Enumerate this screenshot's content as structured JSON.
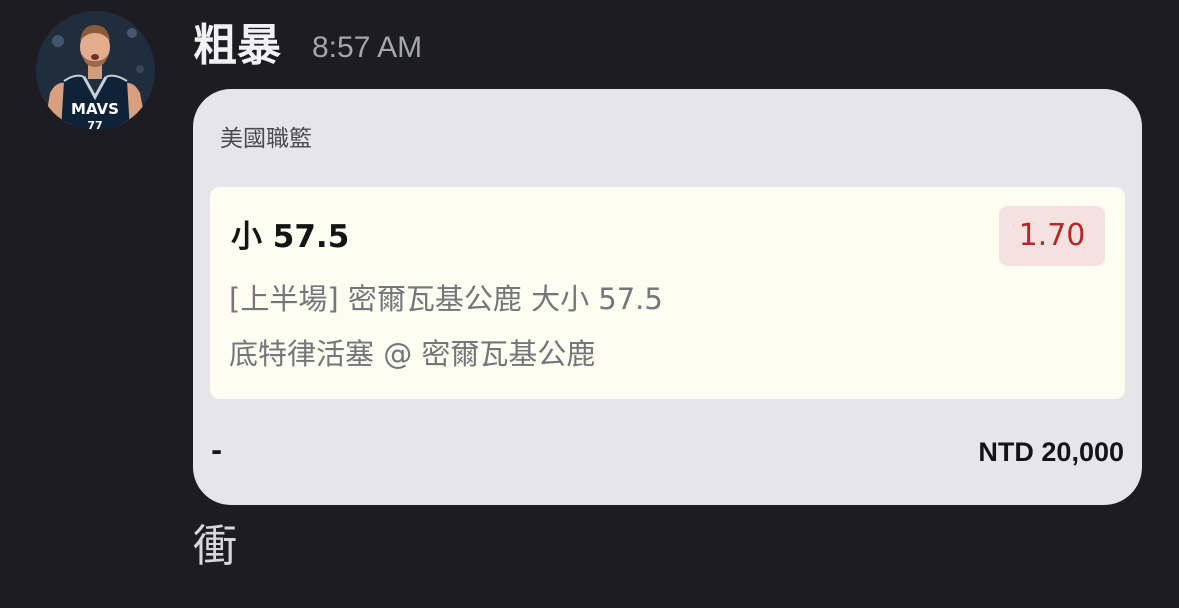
{
  "message": {
    "username": "粗暴",
    "timestamp": "8:57 AM",
    "avatar_icon": "user-avatar-basketball-player",
    "follow_text": "衝"
  },
  "bet_card": {
    "league": "美國職籃",
    "selection": {
      "pick": "小 57.5",
      "odds": "1.70",
      "market": "[上半場] 密爾瓦基公鹿 大小 57.5",
      "event": "底特律活塞 @ 密爾瓦基公鹿"
    },
    "stake_label": "-",
    "stake_value": "NTD 20,000"
  },
  "colors": {
    "background": "#1c1c22",
    "card": "#e6e6ea",
    "selection_bg": "#fdfdf2",
    "odds_bg": "#f5e1df",
    "odds_text": "#b3282c"
  }
}
